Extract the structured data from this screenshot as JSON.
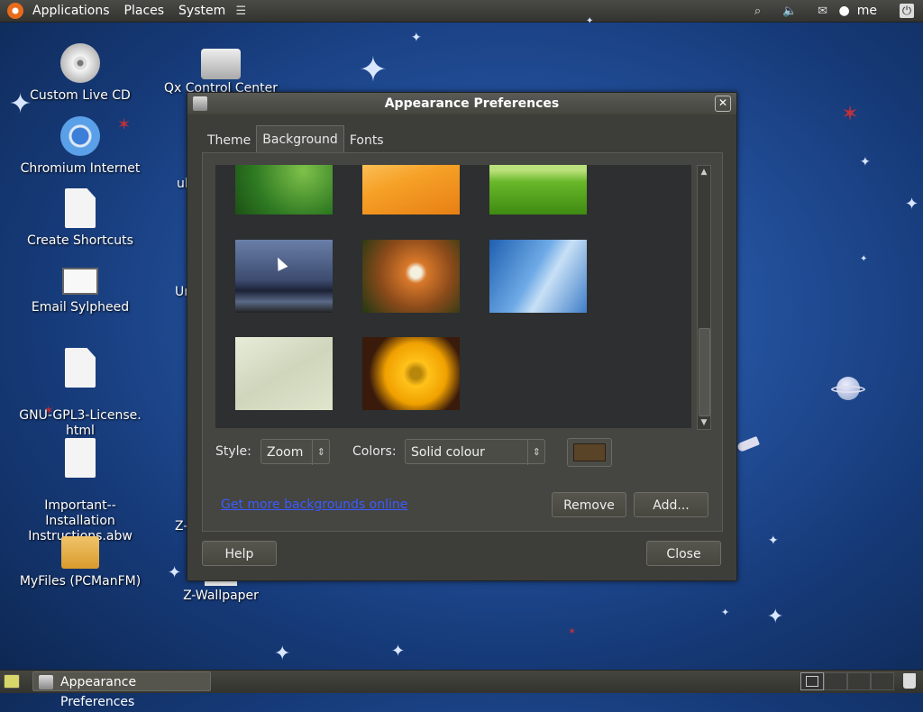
{
  "top_panel": {
    "menus": [
      "Applications",
      "Places",
      "System"
    ],
    "user": "me",
    "tray_icons": [
      "network-icon",
      "volume-icon",
      "mail-icon",
      "user-icon",
      "power-icon"
    ]
  },
  "desktop": {
    "icons": [
      {
        "label": "Custom Live CD",
        "icon": "cd-icon"
      },
      {
        "label": "Chromium Internet",
        "icon": "chromium-icon"
      },
      {
        "label": "Create Shortcuts",
        "icon": "document-icon"
      },
      {
        "label": "Email  Sylpheed",
        "icon": "mail-icon"
      },
      {
        "label": "GNU-GPL3-License.\nhtml",
        "icon": "document-icon"
      },
      {
        "label": "Important--\nInstallation\nInstructions.abw",
        "icon": "abw-document-icon"
      },
      {
        "label": "MyFiles  (PCManFM)",
        "icon": "folder-icon"
      }
    ],
    "second_column": {
      "qx_label": "Qx Control Center",
      "partial_1": "ul",
      "partial_2": "Ur",
      "partial_3": "Z-",
      "z_wallpaper": "Z-Wallpaper"
    }
  },
  "window": {
    "title": "Appearance Preferences",
    "tabs": [
      {
        "label": "Theme",
        "active": false
      },
      {
        "label": "Background",
        "active": true
      },
      {
        "label": "Fonts",
        "active": false
      }
    ],
    "style_label": "Style:",
    "style_value": "Zoom",
    "colors_label": "Colors:",
    "colors_value": "Solid colour",
    "swatch_color": "#5a4428",
    "link_text": "Get more backgrounds online",
    "remove_label": "Remove",
    "add_label": "Add...",
    "help_label": "Help",
    "close_label": "Close"
  },
  "wallpapers": [
    {
      "name": "green-leaf-wallpaper"
    },
    {
      "name": "orange-waves-wallpaper"
    },
    {
      "name": "green-hills-wallpaper"
    },
    {
      "name": "stormy-sky-wallpaper"
    },
    {
      "name": "dandelion-wallpaper"
    },
    {
      "name": "blue-curves-wallpaper"
    },
    {
      "name": "cream-texture-wallpaper"
    },
    {
      "name": "yellow-flower-wallpaper"
    }
  ],
  "bottom_panel": {
    "task_label": "Appearance Preferences"
  }
}
